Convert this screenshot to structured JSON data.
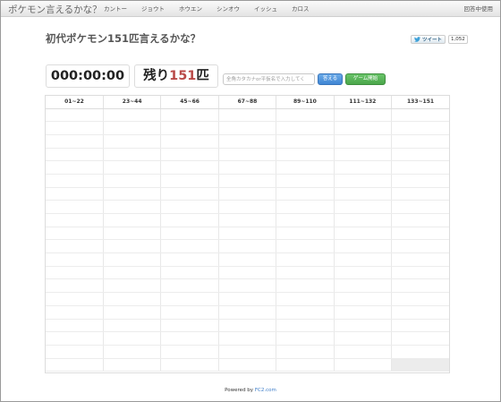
{
  "navbar": {
    "brand": "ポケモン言えるかな？",
    "items": [
      {
        "label": "カントー",
        "active": true
      },
      {
        "label": "ジョウト",
        "active": false
      },
      {
        "label": "ホウエン",
        "active": false
      },
      {
        "label": "シンオウ",
        "active": false
      },
      {
        "label": "イッシュ",
        "active": false
      },
      {
        "label": "カロス",
        "active": false
      }
    ],
    "right_label": "回答中使用"
  },
  "page": {
    "title": "初代ポケモン151匹言えるかな？"
  },
  "tweet": {
    "label": "ツイート",
    "count": "1,052"
  },
  "game": {
    "timer": "000:00:00",
    "remaining_prefix": "残り",
    "remaining_count": "151",
    "remaining_suffix": "匹",
    "input_placeholder": "全角カタカナor平仮名で入力してく",
    "answer_button": "答える",
    "start_button": "ゲーム開始"
  },
  "table": {
    "columns": [
      "01~22",
      "23~44",
      "45~66",
      "67~88",
      "89~110",
      "111~132",
      "133~151"
    ],
    "row_count": 20,
    "column_rows": [
      22,
      22,
      22,
      22,
      22,
      22,
      19
    ]
  },
  "footer": {
    "prefix": "Powered by ",
    "link": "FC2.com"
  }
}
